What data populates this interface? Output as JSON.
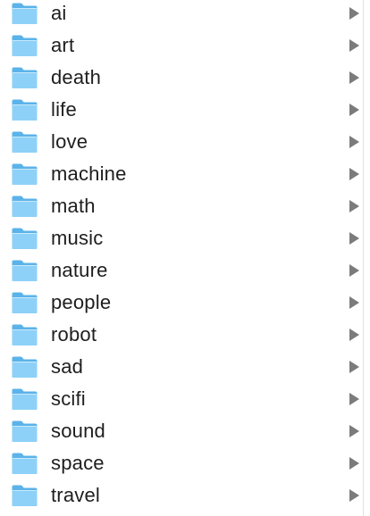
{
  "folders": [
    {
      "label": "ai"
    },
    {
      "label": "art"
    },
    {
      "label": "death"
    },
    {
      "label": "life"
    },
    {
      "label": "love"
    },
    {
      "label": "machine"
    },
    {
      "label": "math"
    },
    {
      "label": "music"
    },
    {
      "label": "nature"
    },
    {
      "label": "people"
    },
    {
      "label": "robot"
    },
    {
      "label": "sad"
    },
    {
      "label": "scifi"
    },
    {
      "label": "sound"
    },
    {
      "label": "space"
    },
    {
      "label": "travel"
    }
  ],
  "icons": {
    "folder": "folder-icon",
    "disclosure": "chevron-right-icon"
  },
  "colors": {
    "folder_body": "#7cc8f5",
    "folder_tab": "#5bb3e9",
    "folder_front": "#8dd1f8",
    "text": "#1e1e1e",
    "chevron": "#7b7b7b",
    "separator": "#e2e2e2"
  }
}
